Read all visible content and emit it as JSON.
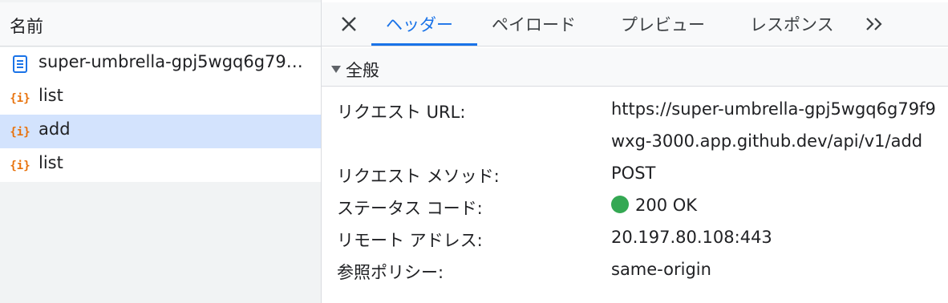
{
  "requests": {
    "header": "名前",
    "items": [
      {
        "name": "super-umbrella-gpj5wgq6g79…",
        "icon": "document-icon",
        "selected": false
      },
      {
        "name": "list",
        "icon": "fetch-xhr-icon",
        "selected": false
      },
      {
        "name": "add",
        "icon": "fetch-xhr-icon",
        "selected": true
      },
      {
        "name": "list",
        "icon": "fetch-xhr-icon",
        "selected": false
      }
    ]
  },
  "tabs": {
    "items": [
      "ヘッダー",
      "ペイロード",
      "プレビュー",
      "レスポンス"
    ],
    "active": "ヘッダー"
  },
  "general": {
    "title": "全般",
    "request_url_label": "リクエスト URL:",
    "request_url_line1": "https://super-umbrella-gpj5wgq6g79f9",
    "request_url_line2": "wxg-3000.app.github.dev/api/v1/add",
    "method_label": "リクエスト メソッド:",
    "method_value": "POST",
    "status_label": "ステータス コード:",
    "status_value": "200 OK",
    "remote_label": "リモート アドレス:",
    "remote_value": "20.197.80.108:443",
    "referrer_label": "参照ポリシー:",
    "referrer_value": "same-origin"
  },
  "colors": {
    "accent": "#1a73e8",
    "selected_row": "#d3e3fd",
    "status_ok": "#34a853",
    "xhr_icon": "#e8710a",
    "doc_icon": "#1a73e8"
  }
}
